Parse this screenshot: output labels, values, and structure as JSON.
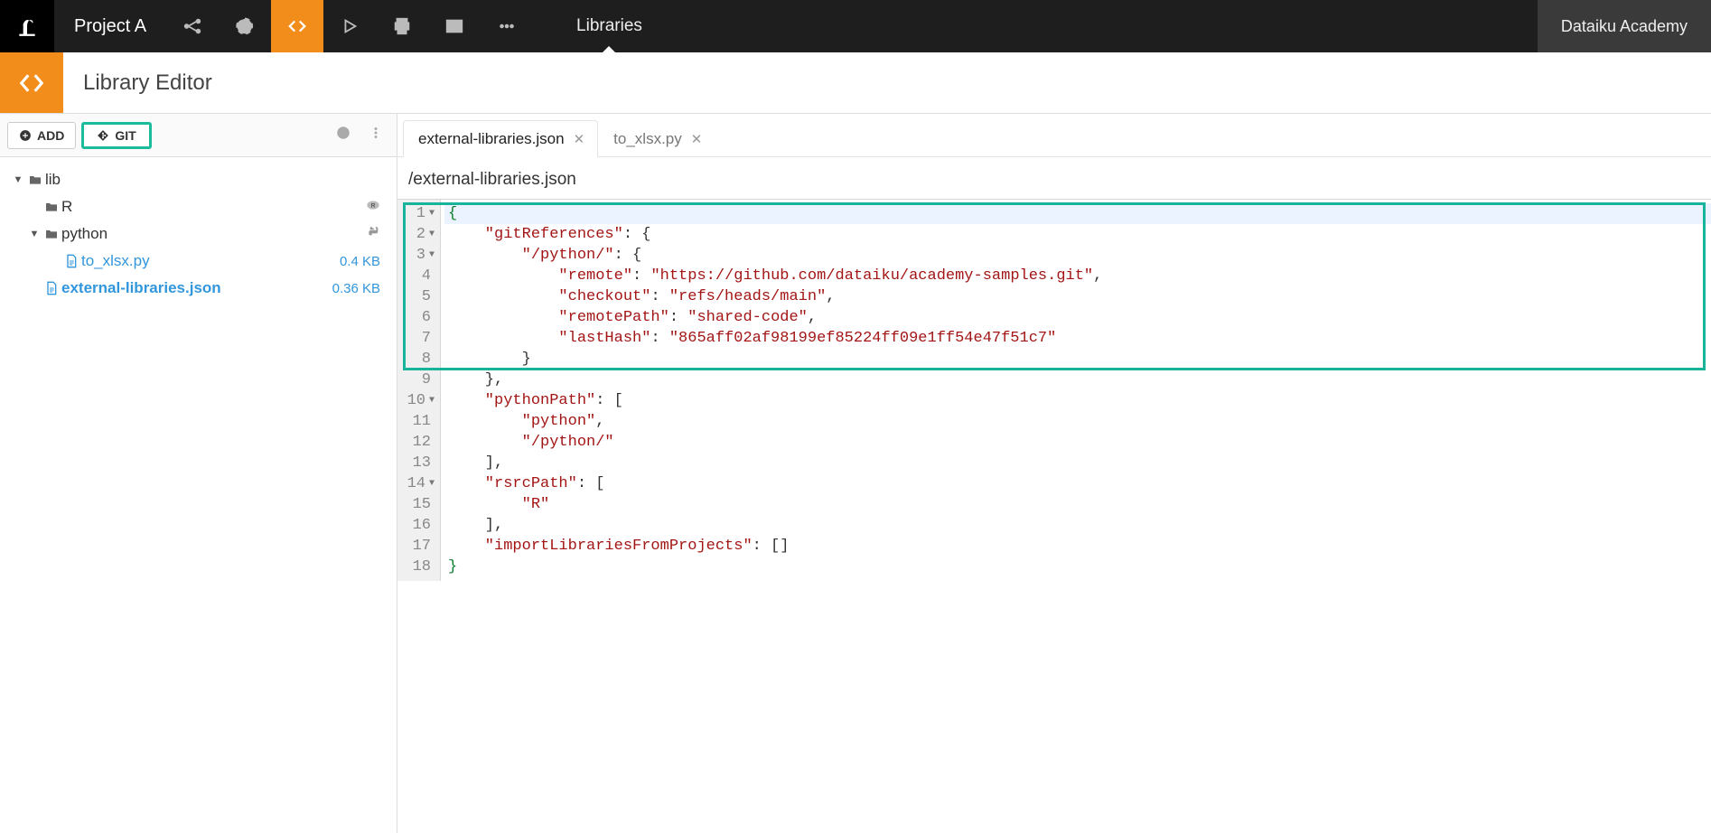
{
  "topbar": {
    "project": "Project A",
    "section": "Libraries",
    "academy": "Dataiku Academy"
  },
  "subheader": {
    "title": "Library Editor"
  },
  "left": {
    "add_label": "ADD",
    "git_label": "GIT",
    "tree": {
      "root": "lib",
      "r_folder": "R",
      "python_folder": "python",
      "file1": {
        "name": "to_xlsx.py",
        "size": "0.4 KB"
      },
      "file2": {
        "name": "external-libraries.json",
        "size": "0.36 KB"
      }
    }
  },
  "tabs": {
    "t1": "external-libraries.json",
    "t2": "to_xlsx.py"
  },
  "filepath": "/external-libraries.json",
  "code": {
    "l1": "{",
    "l2a": "    \"gitReferences\"",
    "l2b": ": {",
    "l3a": "        \"/python/\"",
    "l3b": ": {",
    "l4a": "            \"remote\"",
    "l4b": ": ",
    "l4c": "\"https://github.com/dataiku/academy-samples.git\"",
    "l4d": ",",
    "l5a": "            \"checkout\"",
    "l5b": ": ",
    "l5c": "\"refs/heads/main\"",
    "l5d": ",",
    "l6a": "            \"remotePath\"",
    "l6b": ": ",
    "l6c": "\"shared-code\"",
    "l6d": ",",
    "l7a": "            \"lastHash\"",
    "l7b": ": ",
    "l7c": "\"865aff02af98199ef85224ff09e1ff54e47f51c7\"",
    "l8": "        }",
    "l9": "    },",
    "l10a": "    \"pythonPath\"",
    "l10b": ": [",
    "l11a": "        \"python\"",
    "l11b": ",",
    "l12": "        \"/python/\"",
    "l13": "    ],",
    "l14a": "    \"rsrcPath\"",
    "l14b": ": [",
    "l15": "        \"R\"",
    "l16": "    ],",
    "l17a": "    \"importLibrariesFromProjects\"",
    "l17b": ": []",
    "l18": "}"
  },
  "linenums": {
    "n1": "1",
    "n2": "2",
    "n3": "3",
    "n4": "4",
    "n5": "5",
    "n6": "6",
    "n7": "7",
    "n8": "8",
    "n9": "9",
    "n10": "10",
    "n11": "11",
    "n12": "12",
    "n13": "13",
    "n14": "14",
    "n15": "15",
    "n16": "16",
    "n17": "17",
    "n18": "18"
  }
}
